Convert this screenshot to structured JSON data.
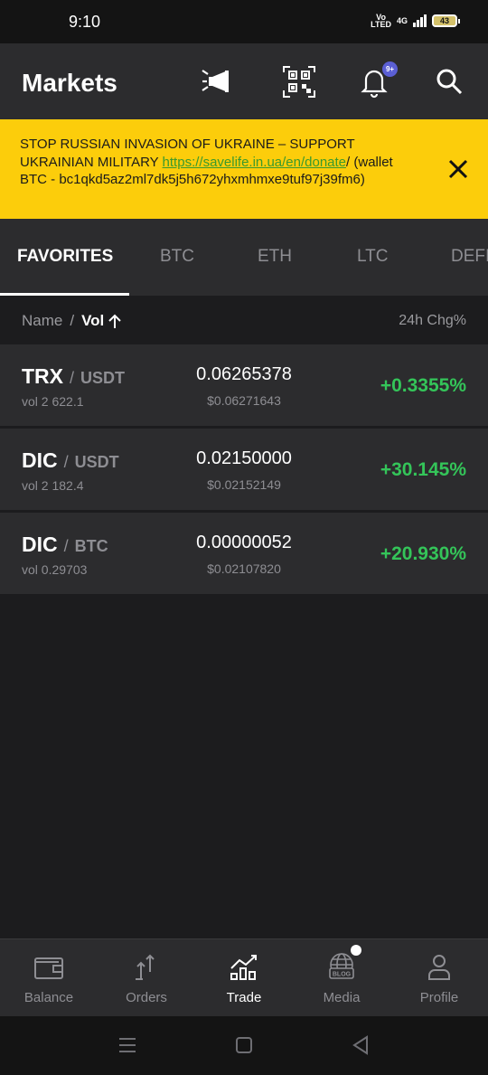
{
  "status": {
    "time": "9:10",
    "volte_top": "Vo",
    "volte_bottom": "LTED",
    "network": "4G",
    "battery": "43"
  },
  "header": {
    "title": "Markets",
    "icons": [
      "announcement-icon",
      "qr-scan-icon",
      "bell-icon",
      "search-icon"
    ],
    "notification_badge": "9+"
  },
  "banner": {
    "text_before_link": "STOP RUSSIAN INVASION OF UKRAINE – SUPPORT UKRAINIAN MILITARY ",
    "link": "https://savelife.in.ua/en/donate",
    "text_after_link": "/ (wallet BTC - bc1qkd5az2ml7dk5j5h672yhxmhmxe9tuf97j39fm6)",
    "background": "#fccd0b"
  },
  "tabs": [
    "FAVORITES",
    "BTC",
    "ETH",
    "LTC",
    "DEFI"
  ],
  "active_tab": "FAVORITES",
  "sort": {
    "name_label": "Name",
    "separator": "/",
    "vol_label": "Vol",
    "change_label": "24h Chg%"
  },
  "rows": [
    {
      "base": "TRX",
      "quote": "USDT",
      "vol": "vol 2 622.1",
      "price": "0.06265378",
      "usd": "$0.06271643",
      "change": "+0.3355%"
    },
    {
      "base": "DIC",
      "quote": "USDT",
      "vol": "vol 2 182.4",
      "price": "0.02150000",
      "usd": "$0.02152149",
      "change": "+30.145%"
    },
    {
      "base": "DIC",
      "quote": "BTC",
      "vol": "vol 0.29703",
      "price": "0.00000052",
      "usd": "$0.02107820",
      "change": "+20.930%"
    }
  ],
  "bottom_nav": [
    {
      "label": "Balance",
      "icon": "wallet-icon"
    },
    {
      "label": "Orders",
      "icon": "orders-icon"
    },
    {
      "label": "Trade",
      "icon": "trade-chart-icon",
      "active": true
    },
    {
      "label": "Media",
      "icon": "blog-globe-icon",
      "icon_text": "BLOG"
    },
    {
      "label": "Profile",
      "icon": "profile-icon"
    }
  ],
  "colors": {
    "positive": "#34c559",
    "surface": "#2c2c2e",
    "background": "#1c1c1e",
    "accent_badge": "#5b5fd4"
  }
}
